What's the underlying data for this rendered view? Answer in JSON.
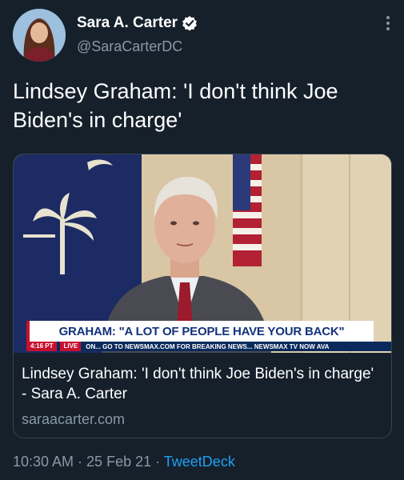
{
  "author": {
    "display_name": "Sara A. Carter",
    "handle": "@SaraCarterDC",
    "verified": true
  },
  "tweet": {
    "text": "Lindsey Graham: 'I don't think Joe Biden's in charge'",
    "timestamp": "10:30 AM · 25 Feb 21 · ",
    "source": "TweetDeck"
  },
  "card": {
    "title": "Lindsey Graham: 'I don't think Joe Biden's in charge' - Sara A. Carter",
    "domain": "saraacarter.com",
    "image": {
      "lower_third": "GRAHAM: \"A LOT OF PEOPLE HAVE YOUR BACK\"",
      "ticker_time": "4:16 PT",
      "ticker_live": "LIVE",
      "ticker_text": "ON...     GO TO NEWSMAX.COM FOR BREAKING NEWS...     NEWSMAX TV NOW AVA"
    }
  },
  "colors": {
    "background": "#15202b",
    "secondary_text": "#8899a6",
    "link": "#1da1f2",
    "verified_badge": "#ffffff"
  }
}
